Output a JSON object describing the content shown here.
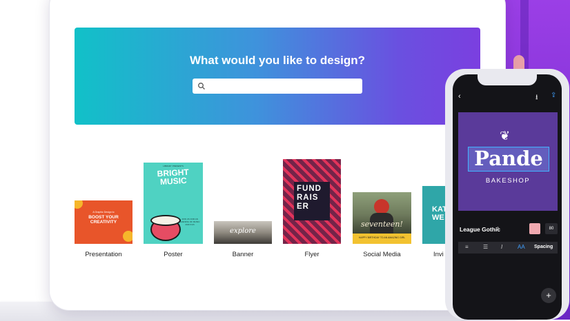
{
  "hero": {
    "title": "What would you like to design?",
    "search_placeholder": ""
  },
  "templates": [
    {
      "label": "Presentation"
    },
    {
      "label": "Poster"
    },
    {
      "label": "Banner"
    },
    {
      "label": "Flyer"
    },
    {
      "label": "Social Media"
    },
    {
      "label": "Invi"
    }
  ],
  "thumbs": {
    "presentation": {
      "small": "A Graphic Design to",
      "text": "BOOST YOUR CREATIVITY"
    },
    "poster": {
      "small": "LIBRARY PRESENTS",
      "title": "BRIGHT MUSIC",
      "body": "JOIN US FOR AN EVENING OF MUSIC AND FUN"
    },
    "banner": {
      "text": "explore"
    },
    "flyer": {
      "text": "FUND RAIS ER"
    },
    "social": {
      "text": "seventeen!",
      "strip": "HAPPY BIRTHDAY TO AN AMAZING GIRL"
    },
    "invite": {
      "text": "KAT WE"
    }
  },
  "phone": {
    "back_icon": "‹",
    "download_icon": "⭳",
    "share_icon": "⇪",
    "design_title": "Pande",
    "design_subtitle": "BAKESHOP",
    "font": "League Gothic",
    "font_caret": "⇕",
    "size": "80",
    "tools": {
      "align": "≡",
      "list": "☰",
      "italic": "I",
      "aa": "AA",
      "spacing": "Spacing"
    },
    "fab": "+"
  },
  "colors": {
    "hero_start": "#11c1c8",
    "hero_end": "#7b3fe0",
    "design_bg": "#5a3a9a",
    "accent": "#3fa0ff"
  }
}
